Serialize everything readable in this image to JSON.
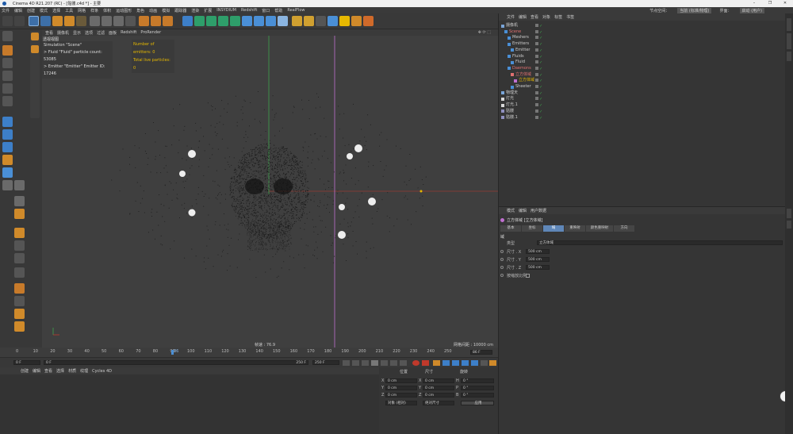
{
  "window": {
    "title": "Cinema 4D R21.207 (RC) - [骷髅.c4d *] - 主要",
    "controls": [
      "–",
      "❐",
      "✕"
    ]
  },
  "menubar": {
    "items": [
      "文件",
      "编辑",
      "创建",
      "模式",
      "选择",
      "工具",
      "网格",
      "样条",
      "体积",
      "运动图形",
      "角色",
      "动画",
      "模拟",
      "跟踪器",
      "渲染",
      "扩展",
      "INSYDIUM",
      "Redshift",
      "窗口",
      "帮助",
      "RealFlow"
    ],
    "node_space_label": "节点空间：",
    "node_space_value": "当前 (标准/物理)",
    "layout_label": "界面：",
    "layout_value": "启动 (用户)"
  },
  "viewport": {
    "menu": [
      "查看",
      "摄像机",
      "显示",
      "选项",
      "过滤",
      "面板",
      "Redshift",
      "ProRender"
    ],
    "label": "透视视图",
    "sim_lines": [
      "Simulation \"Scene\"",
      "> Fluid \"Fluid\" particle count: 53085",
      "> Emitter \"Emitter\" Emitter ID: 17246"
    ],
    "stats": [
      "Number of emitters: 0",
      "Total live particles: 0"
    ],
    "fps": "帧速 : 76.9",
    "grid": "网格间距 : 10000 cm",
    "colors": {
      "x_axis": "#c0392b",
      "y_axis": "#3fa34d",
      "highlight": "#e6b800",
      "vline": "#c070d0"
    }
  },
  "timeline": {
    "ticks": [
      "0",
      "10",
      "20",
      "30",
      "40",
      "50",
      "60",
      "70",
      "80",
      "90",
      "100",
      "110",
      "120",
      "130",
      "140",
      "150",
      "160",
      "170",
      "180",
      "190",
      "200",
      "210",
      "220",
      "230",
      "240",
      "250"
    ],
    "frame_marker": "86",
    "current_frame_field": "86 F"
  },
  "playbar": {
    "start": "0 F",
    "min": "0 F",
    "max": "250 F",
    "end": "250 F"
  },
  "materials": {
    "tabs": [
      "创建",
      "编辑",
      "查看",
      "选择",
      "材质",
      "纹理",
      "Cycles 4D"
    ]
  },
  "coordinates": {
    "headers": [
      "位置",
      "尺寸",
      "旋转"
    ],
    "rows": [
      {
        "axis": "X",
        "pos": "0 cm",
        "size": "0 cm",
        "rot_axis": "H",
        "rot": "0 °"
      },
      {
        "axis": "Y",
        "pos": "0 cm",
        "size": "0 cm",
        "rot_axis": "P",
        "rot": "0 °"
      },
      {
        "axis": "Z",
        "pos": "0 cm",
        "size": "0 cm",
        "rot_axis": "B",
        "rot": "0 °"
      }
    ],
    "mode_left": "对象 (相对)",
    "mode_mid": "绝对尺寸",
    "apply": "应用"
  },
  "objects": {
    "tabs": [
      "文件",
      "编辑",
      "查看",
      "对象",
      "标签",
      "书签"
    ],
    "rows": [
      {
        "name": "摄像机",
        "indent": 0,
        "color": "#cccccc",
        "icon": "#7aa5d8"
      },
      {
        "name": "Scene",
        "indent": 1,
        "color": "#e07070",
        "icon": "#4a8fd6"
      },
      {
        "name": "Meshers",
        "indent": 2,
        "color": "#cccccc",
        "icon": "#4a8fd6"
      },
      {
        "name": "Emitters",
        "indent": 2,
        "color": "#cccccc",
        "icon": "#4a8fd6"
      },
      {
        "name": "Emitter",
        "indent": 3,
        "color": "#cccccc",
        "icon": "#4a8fd6"
      },
      {
        "name": "Fluids",
        "indent": 2,
        "color": "#cccccc",
        "icon": "#4a8fd6"
      },
      {
        "name": "Fluid",
        "indent": 3,
        "color": "#cccccc",
        "icon": "#4a8fd6"
      },
      {
        "name": "Daemons",
        "indent": 2,
        "color": "#e07070",
        "icon": "#4a8fd6"
      },
      {
        "name": "立方体域",
        "indent": 3,
        "color": "#e07070",
        "icon": "#e07070"
      },
      {
        "name": "立方体域",
        "indent": 4,
        "color": "#e6b800",
        "icon": "#c070d0"
      },
      {
        "name": "Sheeter",
        "indent": 3,
        "color": "#cccccc",
        "icon": "#4a8fd6"
      },
      {
        "name": "物理天",
        "indent": 0,
        "color": "#cccccc",
        "icon": "#7aa5d8"
      },
      {
        "name": "灯光",
        "indent": 0,
        "color": "#cccccc",
        "icon": "#d8d8d8"
      },
      {
        "name": "灯光.1",
        "indent": 0,
        "color": "#cccccc",
        "icon": "#d8d8d8"
      },
      {
        "name": "骷髅",
        "indent": 0,
        "color": "#cccccc",
        "icon": "#9090c0"
      },
      {
        "name": "骷髅.1",
        "indent": 0,
        "color": "#cccccc",
        "icon": "#9090c0"
      }
    ]
  },
  "attributes": {
    "tabs": [
      "模式",
      "编辑",
      "用户数据"
    ],
    "object_title": "立方体域 [立方体域]",
    "subtabs": [
      "基本",
      "坐标",
      "域",
      "重映射",
      "颜色重映射",
      "方向"
    ],
    "active_subtab": "域",
    "section": "域",
    "type_label": "类型",
    "type_value": "立方体域",
    "size_fields": [
      {
        "label": "尺寸 . X",
        "value": "500 cm"
      },
      {
        "label": "尺寸 . Y",
        "value": "500 cm"
      },
      {
        "label": "尺寸 . Z",
        "value": "500 cm"
      }
    ],
    "scale_label": "按缩放比例"
  },
  "side_tabs": [
    "对象",
    "内容浏览器",
    "构造",
    "属性",
    "层"
  ]
}
